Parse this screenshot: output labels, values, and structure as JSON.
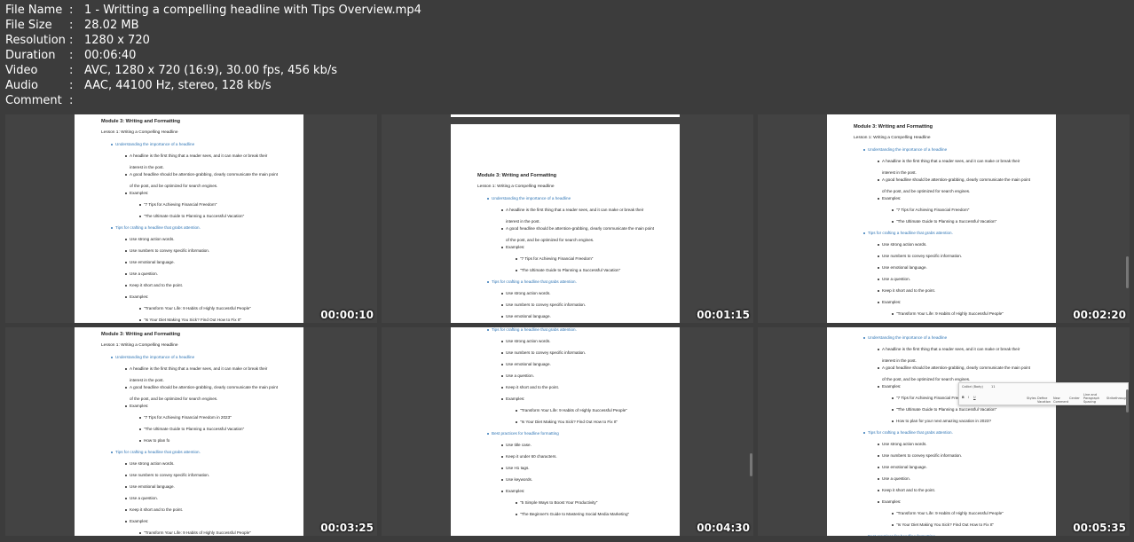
{
  "file_info": [
    {
      "label": "File Name",
      "value": "1 - Writting a compelling headline with Tips Overview.mp4"
    },
    {
      "label": "File Size",
      "value": "28.02 MB"
    },
    {
      "label": "Resolution",
      "value": "1280 x 720"
    },
    {
      "label": "Duration",
      "value": "00:06:40"
    },
    {
      "label": "Video",
      "value": "AVC, 1280 x 720 (16:9), 30.00 fps, 456 kb/s"
    },
    {
      "label": "Audio",
      "value": "AAC, 44100 Hz, stereo, 128 kb/s"
    },
    {
      "label": "Comment",
      "value": ""
    }
  ],
  "separator": ":",
  "thumbnails": [
    {
      "timestamp": "00:00:10",
      "lines": [
        {
          "lvl": "title",
          "text": "Module 3: Writing and Formatting"
        },
        {
          "lvl": "lesson",
          "text": "Lesson 1: Writing a Compelling Headline"
        },
        {
          "lvl": "1",
          "text": "Understanding the importance of a headline"
        },
        {
          "lvl": "2",
          "text": "A headline is the first thing that a reader sees, and it can make or break their"
        },
        {
          "lvl": "2c",
          "text": "interest in the post."
        },
        {
          "lvl": "2",
          "text": "A good headline should be attention-grabbing, clearly communicate the main point"
        },
        {
          "lvl": "2c",
          "text": "of the post, and be optimized for search engines."
        },
        {
          "lvl": "2",
          "text": "Examples:"
        },
        {
          "lvl": "3",
          "text": "\"7 Tips for Achieving Financial Freedom\""
        },
        {
          "lvl": "3",
          "text": "\"The Ultimate Guide to Planning a Successful Vacation\""
        },
        {
          "lvl": "1",
          "text": "Tips for crafting a headline that grabs attention."
        },
        {
          "lvl": "2",
          "text": "Use strong action words."
        },
        {
          "lvl": "2",
          "text": "Use numbers to convey specific information."
        },
        {
          "lvl": "2",
          "text": "Use emotional language."
        },
        {
          "lvl": "2",
          "text": "Use a question."
        },
        {
          "lvl": "2",
          "text": "Keep it short and to the point."
        },
        {
          "lvl": "2",
          "text": "Examples:"
        },
        {
          "lvl": "3",
          "text": "\"Transform Your Life: 9 Habits of Highly Successful People\""
        },
        {
          "lvl": "3",
          "text": "\"Is Your Diet Making You Sick? Find Out How to Fix It\""
        }
      ]
    },
    {
      "timestamp": "00:01:15",
      "lines": [
        {
          "lvl": "title",
          "text": "Module 3: Writing and Formatting"
        },
        {
          "lvl": "lesson",
          "text": "Lesson 1: Writing a Compelling Headline"
        },
        {
          "lvl": "1",
          "text": "Understanding the importance of a headline"
        },
        {
          "lvl": "2",
          "text": "A headline is the first thing that a reader sees, and it can make or break their"
        },
        {
          "lvl": "2c",
          "text": "interest in the post."
        },
        {
          "lvl": "2",
          "text": "A good headline should be attention-grabbing, clearly communicate the main point"
        },
        {
          "lvl": "2c",
          "text": "of the post, and be optimized for search engines."
        },
        {
          "lvl": "2",
          "text": "Examples:"
        },
        {
          "lvl": "3",
          "text": "\"7 Tips for Achieving Financial Freedom\""
        },
        {
          "lvl": "3",
          "text": "\"The Ultimate Guide to Planning a Successful Vacation\""
        },
        {
          "lvl": "1",
          "text": "Tips for crafting a headline that grabs attention."
        },
        {
          "lvl": "2",
          "text": "Use strong action words."
        },
        {
          "lvl": "2",
          "text": "Use numbers to convey specific information."
        },
        {
          "lvl": "2",
          "text": "Use emotional language."
        }
      ]
    },
    {
      "timestamp": "00:02:20",
      "lines": [
        {
          "lvl": "title",
          "text": "Module 3: Writing and Formatting"
        },
        {
          "lvl": "lesson",
          "text": "Lesson 1: Writing a Compelling Headline"
        },
        {
          "lvl": "1",
          "text": "Understanding the importance of a headline"
        },
        {
          "lvl": "2",
          "text": "A headline is the first thing that a reader sees, and it can make or break their"
        },
        {
          "lvl": "2c",
          "text": "interest in the post."
        },
        {
          "lvl": "2",
          "text": "A good headline should be attention-grabbing, clearly communicate the main point"
        },
        {
          "lvl": "2c",
          "text": "of the post, and be optimized for search engines."
        },
        {
          "lvl": "2",
          "text": "Examples:"
        },
        {
          "lvl": "3",
          "text": "\"7 Tips for Achieving Financial Freedom\""
        },
        {
          "lvl": "3",
          "text": "\"The Ultimate Guide to Planning a Successful Vacation\""
        },
        {
          "lvl": "1",
          "text": "Tips for crafting a headline that grabs attention."
        },
        {
          "lvl": "2",
          "text": "Use strong action words."
        },
        {
          "lvl": "2",
          "text": "Use numbers to convey specific information."
        },
        {
          "lvl": "2",
          "text": "Use emotional language."
        },
        {
          "lvl": "2",
          "text": "Use a question."
        },
        {
          "lvl": "2",
          "text": "Keep it short and to the point."
        },
        {
          "lvl": "2",
          "text": "Examples:"
        },
        {
          "lvl": "3",
          "text": "\"Transform Your Life: 9 Habits of Highly Successful People\""
        }
      ]
    },
    {
      "timestamp": "00:03:25",
      "lines": [
        {
          "lvl": "title",
          "text": "Module 3: Writing and Formatting"
        },
        {
          "lvl": "lesson",
          "text": "Lesson 1: Writing a Compelling Headline"
        },
        {
          "lvl": "1",
          "text": "Understanding the importance of a headline"
        },
        {
          "lvl": "2",
          "text": "A headline is the first thing that a reader sees, and it can make or break their"
        },
        {
          "lvl": "2c",
          "text": "interest in the post."
        },
        {
          "lvl": "2",
          "text": "A good headline should be attention-grabbing, clearly communicate the main point"
        },
        {
          "lvl": "2c",
          "text": "of the post, and be optimized for search engines."
        },
        {
          "lvl": "2",
          "text": "Examples:"
        },
        {
          "lvl": "3",
          "text": "\"7 Tips for Achieving Financial Freedom in 2023\""
        },
        {
          "lvl": "3",
          "text": "\"The Ultimate Guide to Planning a Successful Vacation\""
        },
        {
          "lvl": "3",
          "text": "How to plan fo"
        },
        {
          "lvl": "1",
          "text": "Tips for crafting a headline that grabs attention."
        },
        {
          "lvl": "2",
          "text": "Use strong action words."
        },
        {
          "lvl": "2",
          "text": "Use numbers to convey specific information."
        },
        {
          "lvl": "2",
          "text": "Use emotional language."
        },
        {
          "lvl": "2",
          "text": "Use a question."
        },
        {
          "lvl": "2",
          "text": "Keep it short and to the point."
        },
        {
          "lvl": "2",
          "text": "Examples:"
        },
        {
          "lvl": "3",
          "text": "\"Transform Your Life: 9 Habits of Highly Successful People\""
        }
      ]
    },
    {
      "timestamp": "00:04:30",
      "lines": [
        {
          "lvl": "1",
          "text": "Tips for crafting a headline that grabs attention."
        },
        {
          "lvl": "2",
          "text": "Use strong action words."
        },
        {
          "lvl": "2",
          "text": "Use numbers to convey specific information."
        },
        {
          "lvl": "2",
          "text": "Use emotional language."
        },
        {
          "lvl": "2",
          "text": "Use a question."
        },
        {
          "lvl": "2",
          "text": "Keep it short and to the point."
        },
        {
          "lvl": "2",
          "text": "Examples:"
        },
        {
          "lvl": "3",
          "text": "\"Transform Your Life: 9 Habits of Highly Successful People\""
        },
        {
          "lvl": "3",
          "text": "\"Is Your Diet Making You Sick? Find Out How to Fix It\""
        },
        {
          "lvl": "1",
          "text": "Best practices for headline formatting"
        },
        {
          "lvl": "2",
          "text": "Use title case."
        },
        {
          "lvl": "2",
          "text": "Keep it under 60 characters."
        },
        {
          "lvl": "2",
          "text": "Use H1 tags."
        },
        {
          "lvl": "2",
          "text": "Use keywords."
        },
        {
          "lvl": "2",
          "text": "Examples:"
        },
        {
          "lvl": "3",
          "text": "\"5 Simple Ways to Boost Your Productivity\""
        },
        {
          "lvl": "3",
          "text": "\"The Beginner's Guide to Mastering Social Media Marketing\""
        }
      ]
    },
    {
      "timestamp": "00:05:35",
      "lines": [
        {
          "lvl": "1",
          "text": "Understanding the importance of a headline"
        },
        {
          "lvl": "2",
          "text": "A headline is the first thing that a reader sees, and it can make or break their"
        },
        {
          "lvl": "2c",
          "text": "interest in the post."
        },
        {
          "lvl": "2",
          "text": "A good headline should be attention-grabbing, clearly communicate the main point"
        },
        {
          "lvl": "2c",
          "text": "of the post, and be optimized for search engines."
        },
        {
          "lvl": "2",
          "text": "Examples:"
        },
        {
          "lvl": "3",
          "text": "\"7 Tips for Achieving Financial Freedom"
        },
        {
          "lvl": "3",
          "text": "\"The Ultimate Guide to Planning a Successful Vacation\""
        },
        {
          "lvl": "3",
          "text": "How to plan for your next amazing vacation in 2023?"
        },
        {
          "lvl": "1",
          "text": "Tips for crafting a headline that grabs attention."
        },
        {
          "lvl": "2",
          "text": "Use strong action words."
        },
        {
          "lvl": "2",
          "text": "Use numbers to convey specific information."
        },
        {
          "lvl": "2",
          "text": "Use emotional language."
        },
        {
          "lvl": "2",
          "text": "Use a question."
        },
        {
          "lvl": "2",
          "text": "Keep it short and to the point."
        },
        {
          "lvl": "2",
          "text": "Examples:"
        },
        {
          "lvl": "3",
          "text": "\"Transform Your Life: 9 Habits of Highly Successful People\""
        },
        {
          "lvl": "3",
          "text": "\"Is Your Diet Making You Sick? Find Out How to Fix It\""
        },
        {
          "lvl": "1",
          "text": "Best practices for headline formatting"
        }
      ],
      "toolbar": {
        "font": "Calibri (Body)",
        "size": "11",
        "items": [
          "Styles",
          "Define Vacation",
          "New Comment",
          "Center",
          "Line and Paragraph Spacing",
          "Strikethrough"
        ]
      }
    }
  ]
}
